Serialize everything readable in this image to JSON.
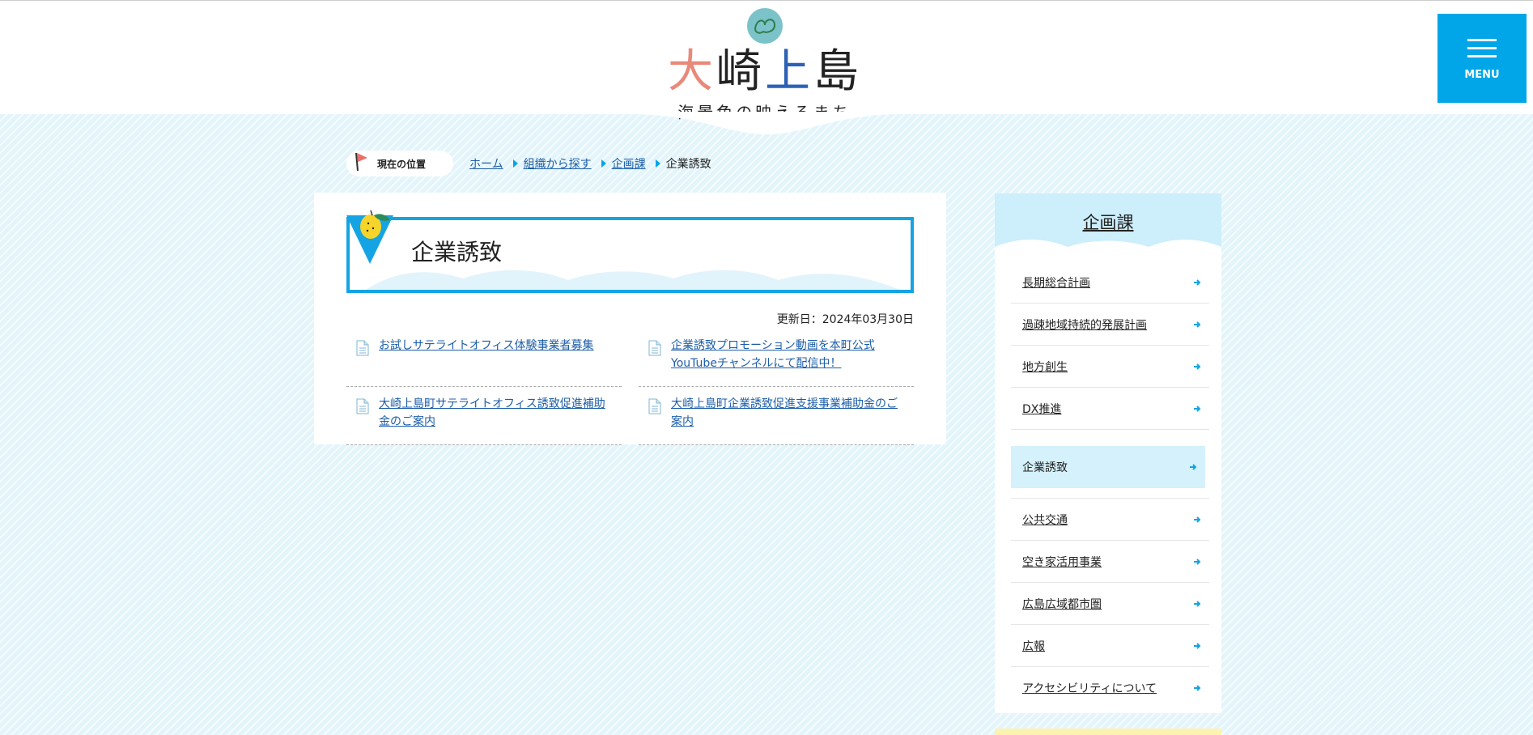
{
  "header": {
    "logo": {
      "title": [
        "大",
        "崎",
        "上",
        "島"
      ],
      "subtitle": "海景色の映えるまち"
    },
    "menu_label": "MENU"
  },
  "breadcrumb": {
    "here_label": "現在の位置",
    "items": [
      "ホーム",
      "組織から探す",
      "企画課"
    ],
    "current": "企業誘致"
  },
  "main": {
    "title": "企業誘致",
    "updated": "更新日：2024年03月30日",
    "links": [
      "お試しサテライトオフィス体験事業者募集",
      "企業誘致プロモーション動画を本町公式YouTubeチャンネルにて配信中！",
      "大崎上島町サテライトオフィス誘致促進補助金のご案内",
      "大崎上島町企業誘致促進支援事業補助金のご案内"
    ]
  },
  "sidebar": {
    "title": "企画課",
    "items": [
      "長期総合計画",
      "過疎地域持続的発展計画",
      "地方創生",
      "DX推進",
      "企業誘致",
      "公共交通",
      "空き家活用事業",
      "広島広域都市圏",
      "広報",
      "アクセシビリティについて"
    ],
    "active_index": 4
  },
  "colors": {
    "accent": "#00a6e8",
    "link": "#1d5ea8",
    "sidebar_head": "#cdeefb",
    "background": "#e3f5fb"
  }
}
